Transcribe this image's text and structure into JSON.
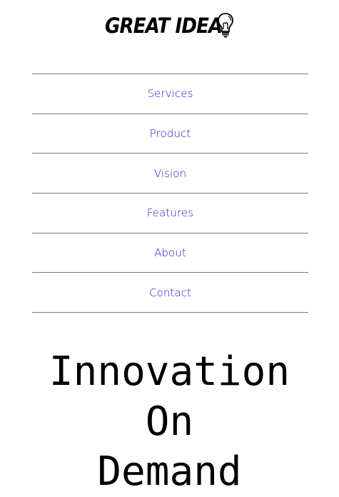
{
  "header": {
    "logo_text": "GREAT IDEA",
    "logo_icon": "lightbulb-icon"
  },
  "nav": {
    "items": [
      {
        "label": "Services"
      },
      {
        "label": "Product"
      },
      {
        "label": "Vision"
      },
      {
        "label": "Features"
      },
      {
        "label": "About"
      },
      {
        "label": "Contact"
      }
    ]
  },
  "hero": {
    "line1": "Innovation",
    "line2": "On",
    "line3": "Demand"
  },
  "colors": {
    "link": "#1a1acc",
    "divider": "#7a7a7a",
    "text": "#000000"
  }
}
